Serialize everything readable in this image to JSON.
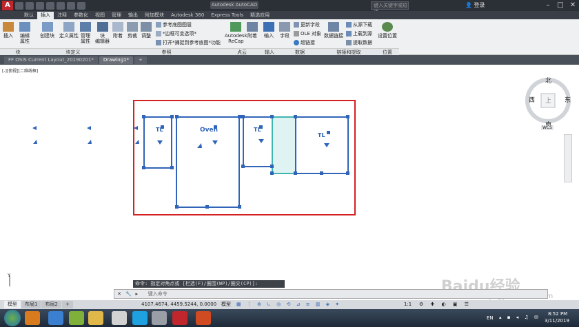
{
  "titlebar": {
    "app_logo": "A",
    "window_title": "Autodesk AutoCAD 2...",
    "search_placeholder": "键入关键字或短语",
    "login_label": "登录"
  },
  "ribbon_tabs": [
    "默认",
    "插入",
    "注释",
    "参数化",
    "视图",
    "管理",
    "输出",
    "附加模块",
    "Autodesk 360",
    "Express Tools",
    "精选应用"
  ],
  "ribbon": {
    "insert_label": "插入",
    "edit_attr_label": "编辑\n属性",
    "create_block_label": "创建块",
    "define_attr_label": "定义属性",
    "manage_attr_label": "管理\n属性",
    "block_editor_label": "块\n编辑器",
    "attach_label": "附着",
    "clip_label": "剪裁",
    "adjust_label": "调整",
    "ref_underlay_layer": "参考底图图层",
    "frame_visibility": "*边框可变选项*",
    "snap_to_underlay": "打开*捕捉到参考底图*功能",
    "recap_label": "Autodesk\nReCap",
    "attach2_label": "附着",
    "import_label": "输入",
    "field_label": "字段",
    "update_fields": "更新字段",
    "ole_object": "OLE 对象",
    "hyperlink": "超链接",
    "data_link_label": "数据链接",
    "download_from_source": "从源下载",
    "upload_to_source": "上载到源",
    "extract_data": "提取数据",
    "set_location_label": "设置位置"
  },
  "panels": [
    "块",
    "块定义",
    "参照",
    "点云",
    "输入",
    "数据",
    "链接和提取",
    "位置"
  ],
  "doc_tabs": [
    "FF OSIS Current Layout_20190201*",
    "Drawing1*"
  ],
  "viewport_label": "[-][俯视][二维线框]",
  "viewcube": {
    "north": "北",
    "south": "南",
    "east": "东",
    "west": "西",
    "center": "上",
    "wcs": "WCS"
  },
  "drawing": {
    "labels": [
      "Oven",
      "TL",
      "TL",
      "TL"
    ]
  },
  "command": {
    "history": "命令: 指定对角点或 [栏选(F)/圈围(WP)/圈交(CP)]:",
    "prompt_placeholder": "键入命令"
  },
  "layout_tabs": [
    "模型",
    "布局1",
    "布局2"
  ],
  "status": {
    "coordinates": "4107.4674, 4459.5244, 0.0000",
    "model_label": "模型",
    "scale": "1:1"
  },
  "taskbar": {
    "lang": "EN",
    "time": "8:52 PM",
    "date": "3/11/2019"
  },
  "watermark": {
    "text": "Baidu经验",
    "url": "jingyan.baidu.com"
  },
  "colors": {
    "selection_box": "#d42020",
    "geometry": "#2f64b8",
    "titlebar": "#2b2f36",
    "taskbar": "#1e2a38"
  }
}
